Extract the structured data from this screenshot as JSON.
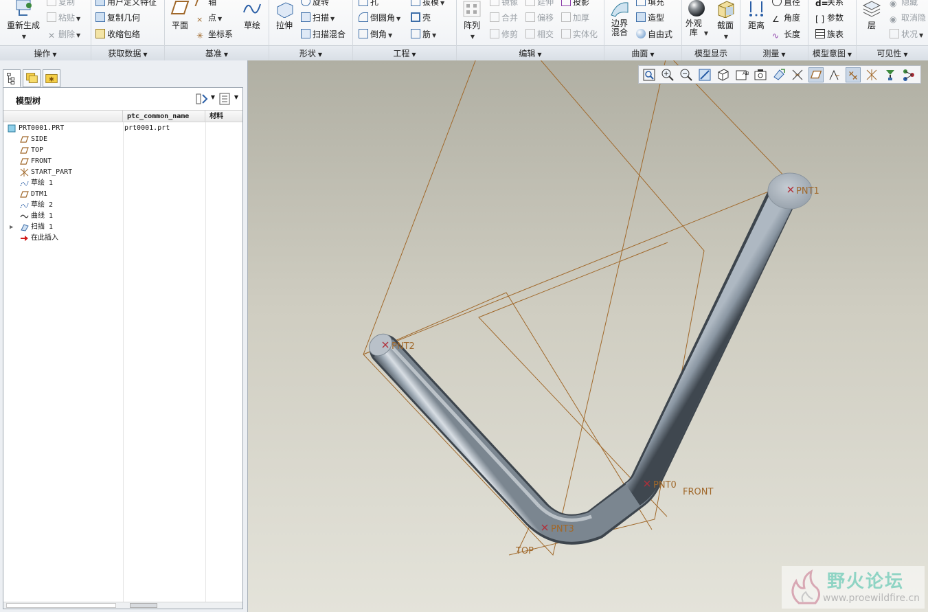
{
  "ribbon": {
    "groups": [
      {
        "label": "操作"
      },
      {
        "label": "获取数据"
      },
      {
        "label": "基准"
      },
      {
        "label": "形状"
      },
      {
        "label": "工程"
      },
      {
        "label": "编辑"
      },
      {
        "label": "曲面"
      },
      {
        "label": "模型显示"
      },
      {
        "label": "测量"
      },
      {
        "label": "模型意图"
      },
      {
        "label": "可见性"
      }
    ],
    "ops": {
      "regenerate": "重新生成",
      "copy": "复制",
      "paste": "粘贴",
      "delete": "删除"
    },
    "getdata": {
      "udf": "用户定义特征",
      "copygeom": "复制几何",
      "shrinkwrap": "收缩包络"
    },
    "datum": {
      "plane": "平面",
      "axis": "轴",
      "point": "点",
      "csys": "坐标系",
      "sketch": "草绘"
    },
    "shapes": {
      "extrude": "拉伸",
      "revolve": "旋转",
      "sweep": "扫描",
      "sweptblend": "扫描混合"
    },
    "engineering": {
      "hole": "孔",
      "round": "倒圆角",
      "chamfer": "倒角",
      "draft": "拔模",
      "shell": "壳",
      "rib": "筋"
    },
    "edit": {
      "pattern": "阵列",
      "mirror": "镜像",
      "merge": "合并",
      "trim": "修剪",
      "extend": "延伸",
      "offset": "偏移",
      "intersect": "相交",
      "project": "投影",
      "thicken": "加厚",
      "solidify": "实体化"
    },
    "surfaces": {
      "boundary": "边界混合",
      "fill": "填充",
      "style": "造型",
      "freestyle": "自由式"
    },
    "display": {
      "appearance": "外观库",
      "section": "截面"
    },
    "measure": {
      "distance": "距离",
      "diameter": "直径",
      "angle": "角度",
      "length": "长度"
    },
    "intent": {
      "relations": "关系",
      "parameters": "参数",
      "familytable": "族表"
    },
    "visibility": {
      "layers": "层",
      "hide": "隐藏",
      "unhide": "取消隐",
      "status": "状况"
    }
  },
  "modeltree": {
    "title": "模型树",
    "columns": [
      "ptc_common_name",
      "材料"
    ],
    "rows": [
      {
        "label": "PRT0001.PRT",
        "value": "prt0001.prt",
        "icon": "part-icon",
        "indent": 0
      },
      {
        "label": "SIDE",
        "value": "",
        "icon": "datum-plane-icon",
        "indent": 1
      },
      {
        "label": "TOP",
        "value": "",
        "icon": "datum-plane-icon",
        "indent": 1
      },
      {
        "label": "FRONT",
        "value": "",
        "icon": "datum-plane-icon",
        "indent": 1
      },
      {
        "label": "START_PART",
        "value": "",
        "icon": "csys-icon",
        "indent": 1
      },
      {
        "label": "草绘 1",
        "value": "",
        "icon": "sketch-icon",
        "indent": 1
      },
      {
        "label": "DTM1",
        "value": "",
        "icon": "datum-plane-icon",
        "indent": 1
      },
      {
        "label": "草绘 2",
        "value": "",
        "icon": "sketch-icon",
        "indent": 1
      },
      {
        "label": "曲线 1",
        "value": "",
        "icon": "curve-icon",
        "indent": 1
      },
      {
        "label": "扫描 1",
        "value": "",
        "icon": "sweep-icon",
        "indent": 1,
        "expandable": true
      },
      {
        "label": "在此插入",
        "value": "",
        "icon": "insert-here-icon",
        "indent": 1
      }
    ]
  },
  "viewport": {
    "points": [
      "PNT1",
      "PNT2",
      "PNT0",
      "PNT3"
    ],
    "planes": [
      "FRONT",
      "TOP"
    ]
  },
  "watermark": {
    "title": "野火论坛",
    "url": "www.proewildfire.cn"
  },
  "colors": {
    "accent": "#a0682a",
    "point_marker": "#b0303a",
    "tube": "#8e9aa6"
  }
}
